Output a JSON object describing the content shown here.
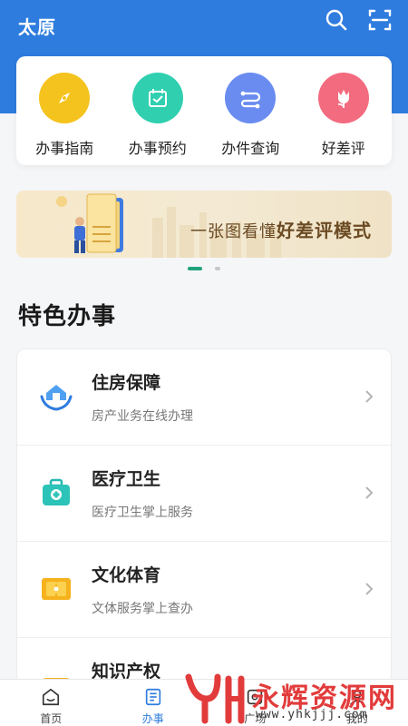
{
  "header": {
    "city": "太原",
    "search_icon": "search-icon",
    "scan_icon": "scan-icon",
    "color": "#2f7cdf"
  },
  "quick_actions": [
    {
      "label": "办事指南",
      "icon": "compass-icon",
      "color": "#f5c31d"
    },
    {
      "label": "办事预约",
      "icon": "calendar-check-icon",
      "color": "#2fcfb0"
    },
    {
      "label": "办件查询",
      "icon": "flow-icon",
      "color": "#6a8cf0"
    },
    {
      "label": "好差评",
      "icon": "flower-icon",
      "color": "#f36b7f"
    }
  ],
  "banner": {
    "text_prefix": "一张图看懂",
    "text_highlight": "好差评模式",
    "art_label": "好差评"
  },
  "carousel": {
    "count": 2,
    "active": 0
  },
  "section": {
    "title": "特色办事"
  },
  "services": [
    {
      "title": "住房保障",
      "subtitle": "房产业务在线办理",
      "icon": "house-hands-icon"
    },
    {
      "title": "医疗卫生",
      "subtitle": "医疗卫生掌上服务",
      "icon": "medical-kit-icon"
    },
    {
      "title": "文化体育",
      "subtitle": "文体服务掌上查办",
      "icon": "ticket-icon"
    },
    {
      "title": "知识产权",
      "subtitle": "",
      "icon": "folder-icon"
    }
  ],
  "bottom_nav": [
    {
      "label": "首页",
      "icon": "home-icon",
      "active": false
    },
    {
      "label": "办事",
      "icon": "document-icon",
      "active": true
    },
    {
      "label": "广场",
      "icon": "square-icon",
      "active": false
    },
    {
      "label": "我的",
      "icon": "profile-icon",
      "active": false
    }
  ],
  "watermark": {
    "text": "永辉资源网",
    "url": "www.yhkjjj.com"
  }
}
